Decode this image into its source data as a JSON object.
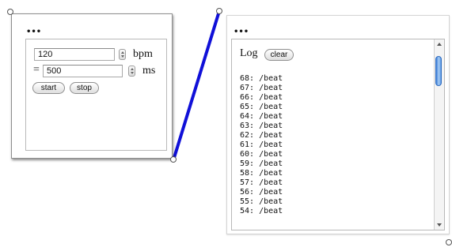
{
  "left_patch": {
    "dots_label": "•••",
    "bpm_value": "120",
    "bpm_unit": "bpm",
    "equals_sign": "=",
    "ms_value": "500",
    "ms_unit": "ms",
    "start_label": "start",
    "stop_label": "stop"
  },
  "right_patch": {
    "dots_label": "•••",
    "log_title": "Log",
    "clear_label": "clear",
    "log_lines": [
      "68: /beat",
      "67: /beat",
      "66: /beat",
      "65: /beat",
      "64: /beat",
      "63: /beat",
      "62: /beat",
      "61: /beat",
      "60: /beat",
      "59: /beat",
      "58: /beat",
      "57: /beat",
      "56: /beat",
      "55: /beat",
      "54: /beat"
    ],
    "scroll_position": 0.05
  },
  "connection": {
    "color": "#1010d8"
  }
}
